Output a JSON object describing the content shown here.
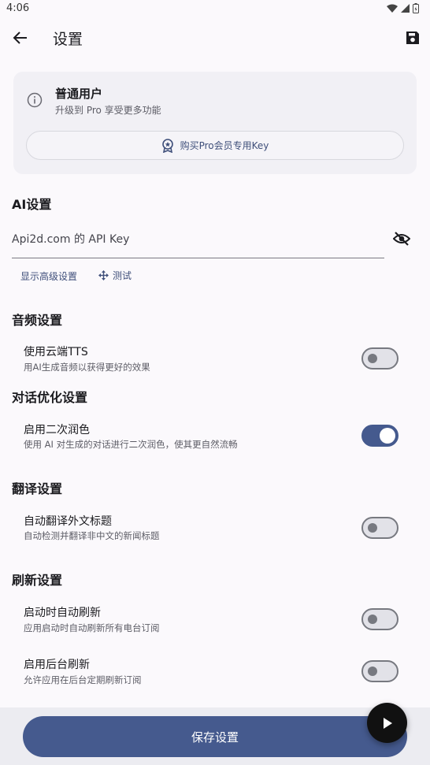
{
  "status_bar": {
    "time": "4:06"
  },
  "app_bar": {
    "title": "设置"
  },
  "pro_card": {
    "user_type": "普通用户",
    "upgrade_hint": "升级到 Pro 享受更多功能",
    "buy_button": "购买Pro会员专用Key"
  },
  "ai_section": {
    "title": "AI设置",
    "api_key_placeholder": "Api2d.com 的 API Key",
    "advanced_link": "显示高级设置",
    "test_link": "测试"
  },
  "audio_section": {
    "title": "音频设置",
    "cloud_tts": {
      "title": "使用云端TTS",
      "subtitle": "用AI生成音频以获得更好的效果",
      "enabled": false
    }
  },
  "dialog_section": {
    "title": "对话优化设置",
    "polish": {
      "title": "启用二次润色",
      "subtitle": "使用 AI 对生成的对话进行二次润色，使其更自然流畅",
      "enabled": true
    }
  },
  "translate_section": {
    "title": "翻译设置",
    "auto_translate": {
      "title": "自动翻译外文标题",
      "subtitle": "自动检测并翻译非中文的新闻标题",
      "enabled": false
    }
  },
  "refresh_section": {
    "title": "刷新设置",
    "startup_refresh": {
      "title": "启动时自动刷新",
      "subtitle": "应用启动时自动刷新所有电台订阅",
      "enabled": false
    },
    "background_refresh": {
      "title": "启用后台刷新",
      "subtitle": "允许应用在后台定期刷新订阅",
      "enabled": false
    }
  },
  "bottom": {
    "save_button": "保存设置"
  },
  "icons": {
    "back": "arrow-left-icon",
    "save": "floppy-disk-icon",
    "info": "info-circle-icon",
    "award": "award-badge-icon",
    "visibility": "eye-off-icon",
    "test": "move-arrows-icon",
    "play": "play-icon"
  },
  "colors": {
    "primary": "#455a8e",
    "link": "#3f4f7a",
    "card_bg": "#f1f0f5",
    "background": "#fbf9fc"
  }
}
